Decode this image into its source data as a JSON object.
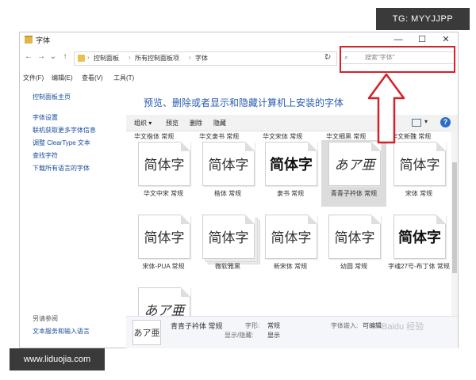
{
  "watermarks": {
    "top": "TG: MYYJJPP",
    "bottom": "www.liduojia.com",
    "baidu": "Baidu 经验"
  },
  "window": {
    "title": "字体",
    "controls": {
      "minimize": "—",
      "maximize": "☐",
      "close": "✕"
    }
  },
  "address": {
    "nav": {
      "back": "←",
      "forward": "→",
      "recent": "⌄",
      "up": "↑"
    },
    "crumbs": [
      "控制面板",
      "所有控制面板项",
      "字体"
    ],
    "separator": "›",
    "dropdown": "⌄",
    "refresh": "↻",
    "search_placeholder": "搜索\"字体\"",
    "search_icon": "⌕"
  },
  "menu": [
    "文件(F)",
    "编辑(E)",
    "查看(V)",
    "工具(T)"
  ],
  "left_pane": {
    "home": "控制面板主页",
    "links": [
      "字体设置",
      "联机获取更多字体信息",
      "调整 ClearType 文本",
      "查找字符",
      "下载所有语言的字体"
    ],
    "see_also": "另请参阅",
    "see_also_links": [
      "文本服务和输入语言"
    ]
  },
  "heading": "预览、删除或者显示和隐藏计算机上安装的字体",
  "toolbar": {
    "organize": "组织 ▾",
    "preview": "预览",
    "delete": "删除",
    "hide": "隐藏",
    "view_caret": "▾",
    "help": "?"
  },
  "top_row_labels": [
    "华文楷体 常规",
    "华文隶书 常规",
    "华文宋体 常规",
    "华文细黑 常规",
    "华文新魏 常规"
  ],
  "fonts": [
    {
      "glyph": "简体字",
      "label": "华文中宋 常规",
      "style": "serif",
      "selected": false,
      "stack": false
    },
    {
      "glyph": "简体字",
      "label": "楷体 常规",
      "style": "plain",
      "selected": false,
      "stack": false
    },
    {
      "glyph": "简体字",
      "label": "隶书 常规",
      "style": "bold",
      "selected": false,
      "stack": false
    },
    {
      "glyph": "あア亜",
      "label": "青青子衿体 常规",
      "style": "hand",
      "selected": true,
      "stack": false
    },
    {
      "glyph": "简体字",
      "label": "宋体 常规",
      "style": "plain",
      "selected": false,
      "stack": false
    },
    {
      "glyph": "简体字",
      "label": "宋体-PUA 常规",
      "style": "plain",
      "selected": false,
      "stack": false
    },
    {
      "glyph": "简体字",
      "label": "微软雅黑",
      "style": "plain",
      "selected": false,
      "stack": true
    },
    {
      "glyph": "简体字",
      "label": "新宋体 常规",
      "style": "plain",
      "selected": false,
      "stack": false
    },
    {
      "glyph": "简体字",
      "label": "幼圆 常规",
      "style": "plain",
      "selected": false,
      "stack": false
    },
    {
      "glyph": "简体字",
      "label": "字魂27号-布丁体 常规",
      "style": "bold",
      "selected": false,
      "stack": false
    },
    {
      "glyph": "あア亜",
      "label": "",
      "style": "hand",
      "selected": false,
      "stack": false
    }
  ],
  "details": {
    "glyph": "あア亜",
    "name": "青青子衿体 常规",
    "style_label": "字形:",
    "style_value": "常规",
    "show_label": "显示/隐藏:",
    "show_value": "显示",
    "embed_label": "字体嵌入:",
    "embed_value": "可编辑"
  },
  "colors": {
    "annotation": "#d6202a",
    "link": "#1a4d9c",
    "heading": "#2a5db0"
  }
}
